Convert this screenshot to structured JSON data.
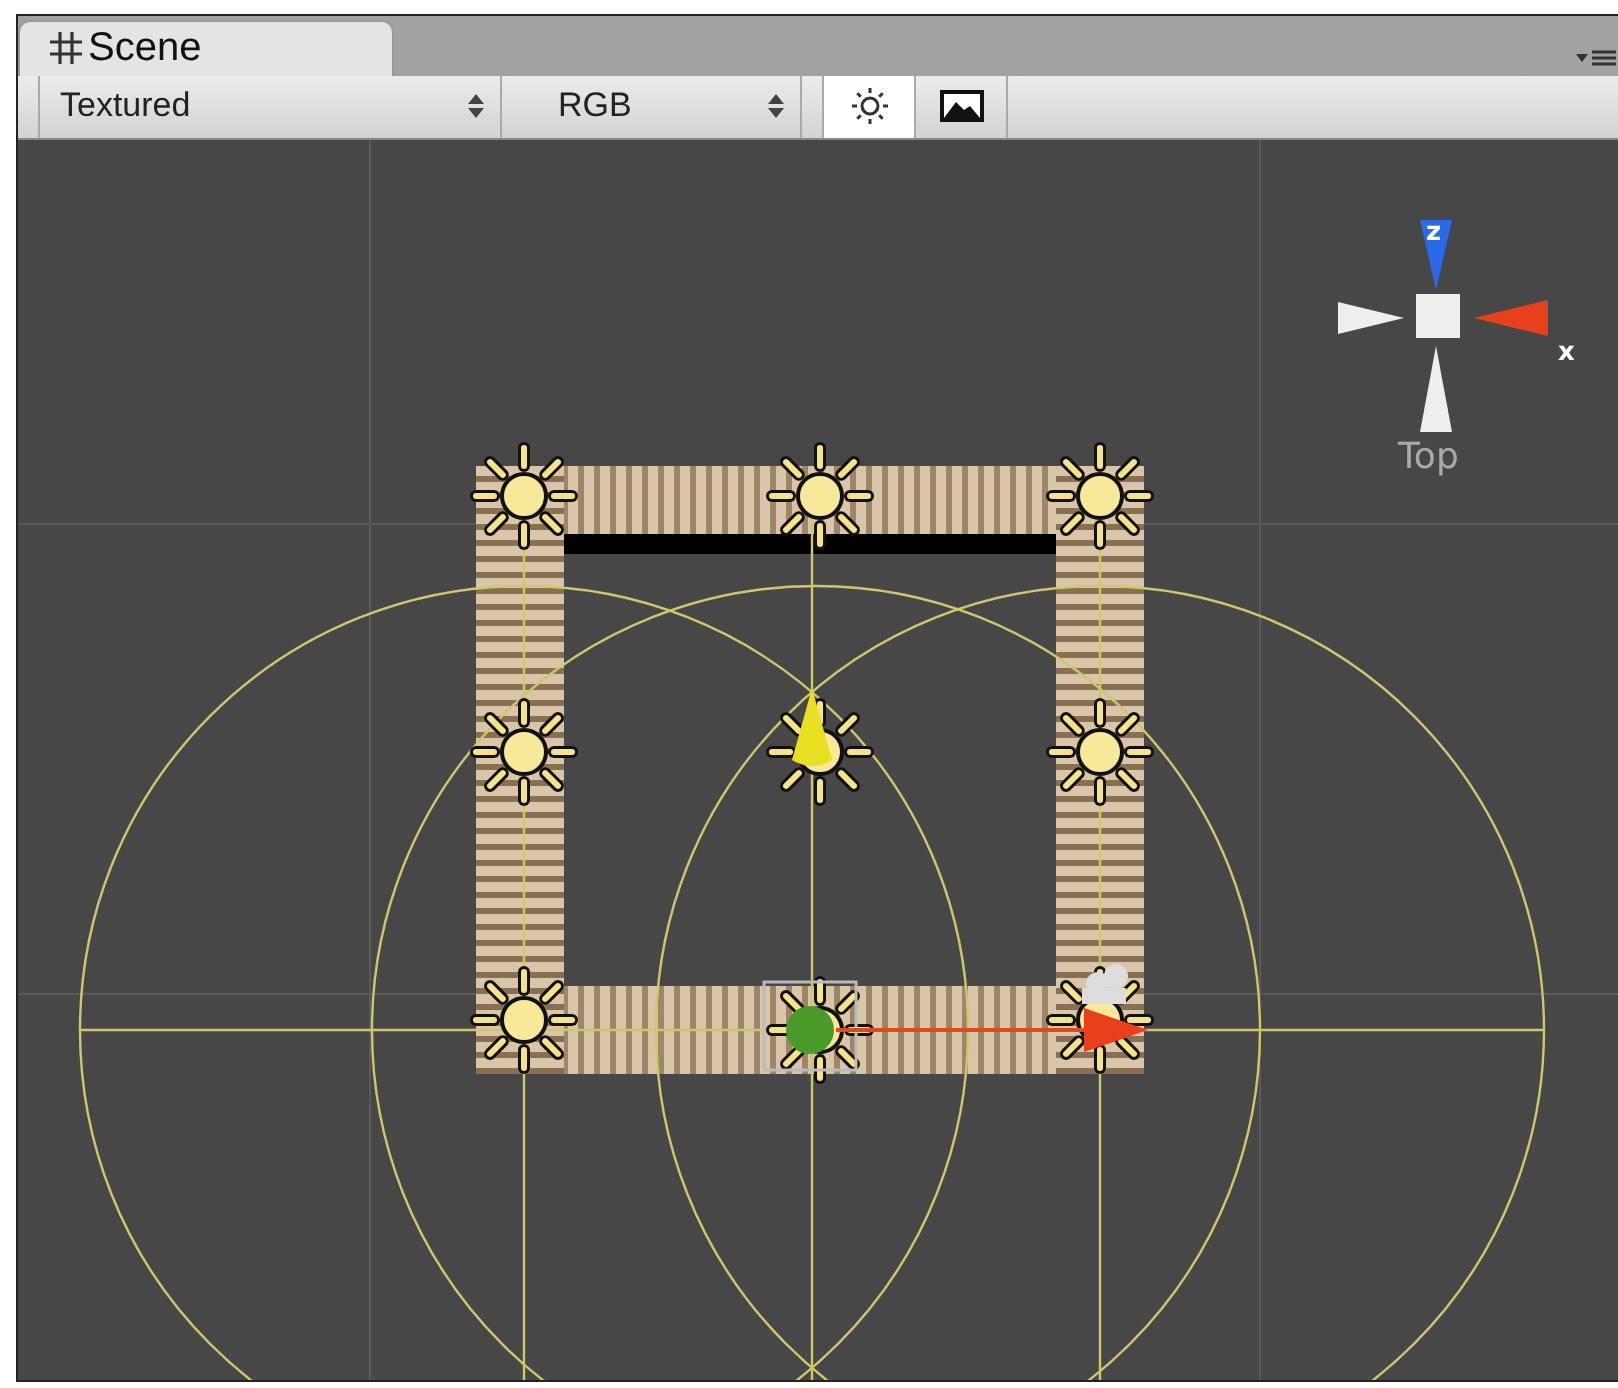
{
  "tab": {
    "label": "Scene",
    "selected": true
  },
  "toolbar": {
    "dropdowns": [
      {
        "value": "Textured"
      },
      {
        "value": "RGB"
      }
    ],
    "toggles": [
      {
        "kind": "lighting",
        "selected": true
      },
      {
        "kind": "image",
        "selected": false
      }
    ]
  },
  "gizmo": {
    "axes": [
      {
        "label": "z"
      },
      {
        "label": "x"
      }
    ],
    "view_label": "Top"
  }
}
